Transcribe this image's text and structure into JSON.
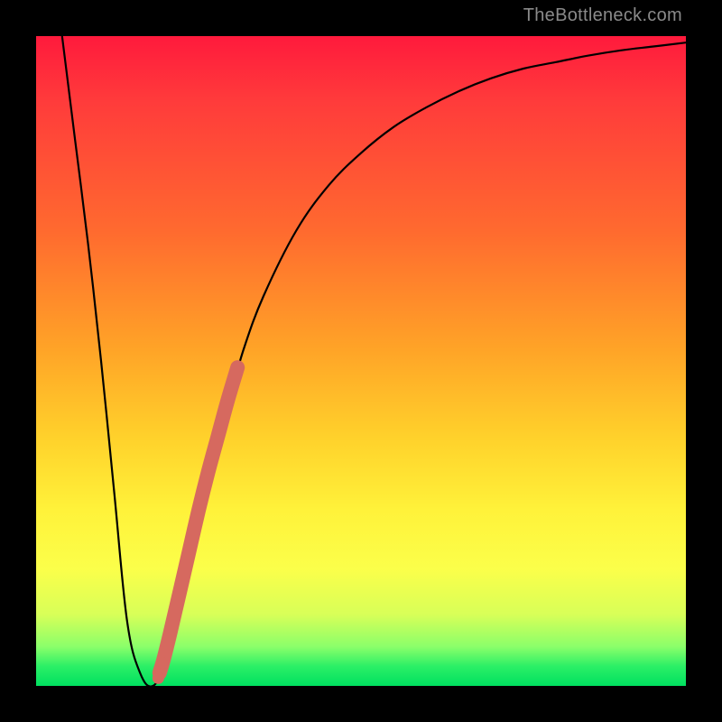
{
  "watermark": "TheBottleneck.com",
  "colors": {
    "curve_stroke": "#000000",
    "marker_fill": "#d6695f",
    "gradient_top": "#ff1a3c",
    "gradient_bottom": "#00e060",
    "frame": "#000000"
  },
  "chart_data": {
    "type": "line",
    "title": "",
    "xlabel": "",
    "ylabel": "",
    "xlim": [
      0,
      100
    ],
    "ylim": [
      0,
      100
    ],
    "grid": false,
    "legend": false,
    "series": [
      {
        "name": "bottleneck-curve",
        "x": [
          4,
          6,
          8,
          10,
          12,
          14,
          16,
          18,
          20,
          22,
          24,
          26,
          28,
          30,
          32,
          35,
          40,
          45,
          50,
          55,
          60,
          65,
          70,
          75,
          80,
          85,
          90,
          95,
          100
        ],
        "values": [
          100,
          84,
          68,
          50,
          30,
          10,
          2,
          0,
          4,
          12,
          22,
          30,
          38,
          45,
          52,
          60,
          70,
          77,
          82,
          86,
          89,
          91.5,
          93.5,
          95,
          96,
          97,
          97.8,
          98.4,
          99
        ]
      }
    ],
    "markers": {
      "name": "highlight-segment",
      "x": [
        19.0,
        19.6,
        20.6,
        22.0,
        23.5,
        25.0,
        26.5,
        28.0,
        29.5,
        31.0
      ],
      "values": [
        2.0,
        4.0,
        8.0,
        14.0,
        20.5,
        27.0,
        33.0,
        38.5,
        44.0,
        49.0
      ]
    }
  }
}
